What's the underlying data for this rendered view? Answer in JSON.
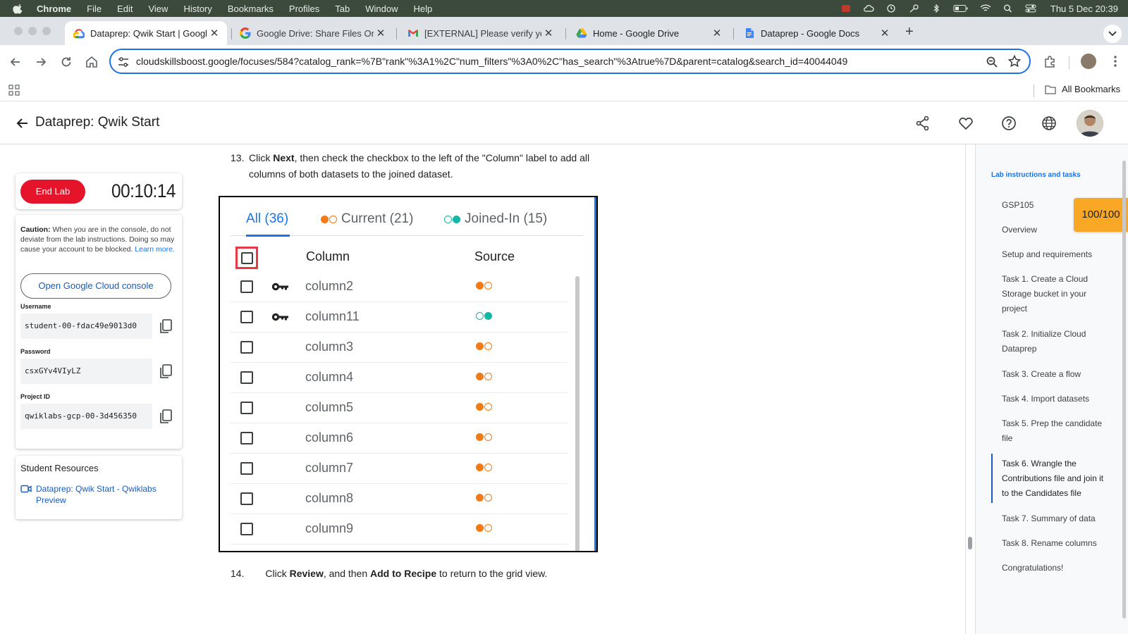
{
  "os_menubar": {
    "app": "Chrome",
    "items": [
      "File",
      "Edit",
      "View",
      "History",
      "Bookmarks",
      "Profiles",
      "Tab",
      "Window",
      "Help"
    ],
    "clock": "Thu 5 Dec  20:39"
  },
  "browser": {
    "tabs": [
      {
        "title": "Dataprep: Qwik Start | Google",
        "icon": "google-cloud-icon",
        "active": true
      },
      {
        "title": "Google Drive: Share Files Onl",
        "icon": "google-g-icon"
      },
      {
        "title": "[EXTERNAL] Please verify yo",
        "icon": "gmail-icon"
      },
      {
        "title": "Home - Google Drive",
        "icon": "google-drive-icon"
      },
      {
        "title": "Dataprep - Google Docs",
        "icon": "google-docs-icon"
      }
    ],
    "url": "cloudskillsboost.google/focuses/584?catalog_rank=%7B\"rank\"%3A1%2C\"num_filters\"%3A0%2C\"has_search\"%3Atrue%7D&parent=catalog&search_id=40044049",
    "bookmarks_label": "All Bookmarks"
  },
  "page": {
    "title": "Dataprep: Qwik Start"
  },
  "lab": {
    "end_label": "End Lab",
    "timer": "00:10:14",
    "caution_bold": "Caution:",
    "caution_text": " When you are in the console, do not deviate from the lab instructions. Doing so may cause your account to be blocked.",
    "learn_more": "Learn more.",
    "open_console": "Open Google Cloud console",
    "username_label": "Username",
    "username": "student-00-fdac49e9013d0",
    "password_label": "Password",
    "password": "csxGYv4VIyLZ",
    "project_label": "Project ID",
    "project": "qwiklabs-gcp-00-3d456350",
    "resources_title": "Student Resources",
    "resource_link": "Dataprep: Qwik Start - Qwiklabs Preview"
  },
  "content": {
    "step13_num": "13.",
    "step13_a": "Click ",
    "step13_b": "Next",
    "step13_c": ", then check the checkbox to the left of the \"Column\" label to add all columns of both datasets to the joined dataset.",
    "step14_num": "14.",
    "step14_a": "Click ",
    "step14_b": "Review",
    "step14_c": ", and then ",
    "step14_d": "Add to Recipe",
    "step14_e": " to return to the grid view.",
    "screenshot": {
      "tabs": [
        "All (36)",
        "Current (21)",
        "Joined-In (15)"
      ],
      "col_header": "Column",
      "src_header": "Source",
      "rows": [
        {
          "name": "column2",
          "key": true,
          "source": "current"
        },
        {
          "name": "column11",
          "key": true,
          "source": "joined"
        },
        {
          "name": "column3",
          "key": false,
          "source": "current"
        },
        {
          "name": "column4",
          "key": false,
          "source": "current"
        },
        {
          "name": "column5",
          "key": false,
          "source": "current"
        },
        {
          "name": "column6",
          "key": false,
          "source": "current"
        },
        {
          "name": "column7",
          "key": false,
          "source": "current"
        },
        {
          "name": "column8",
          "key": false,
          "source": "current"
        },
        {
          "name": "column9",
          "key": false,
          "source": "current"
        }
      ]
    }
  },
  "toc": {
    "title": "Lab instructions and tasks",
    "score": "100/100",
    "items": [
      "GSP105",
      "Overview",
      "Setup and requirements",
      "Task 1. Create a Cloud Storage bucket in your project",
      "Task 2. Initialize Cloud Dataprep",
      "Task 3. Create a flow",
      "Task 4. Import datasets",
      "Task 5. Prep the candidate file",
      "Task 6. Wrangle the Contributions file and join it to the Candidates file",
      "Task 7. Summary of data",
      "Task 8. Rename columns",
      "Congratulations!"
    ],
    "active_index": 8
  },
  "colors": {
    "accent": "#1a73e8",
    "end_lab": "#e5142a",
    "score": "#f9a825",
    "current_source": "#f07b17",
    "joined_source": "#12b8a6"
  }
}
